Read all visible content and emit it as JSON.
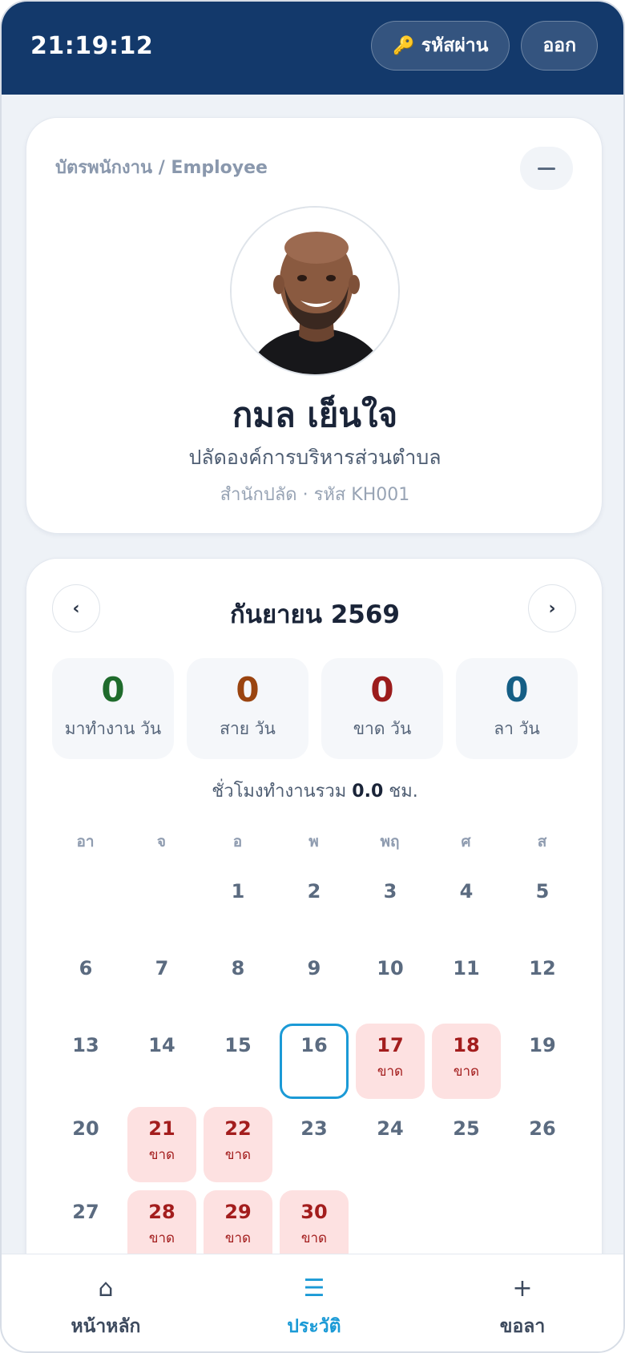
{
  "header": {
    "clock": "21:19:12",
    "password_label": "รหัสผ่าน",
    "password_icon": "key-icon",
    "logout_label": "ออก"
  },
  "employee": {
    "card_label": "บัตรพนักงาน / Employee",
    "name": "กมล เย็นใจ",
    "role": "ปลัดองค์การบริหารส่วนตำบล",
    "meta": "สำนักปลัด · รหัส KH001"
  },
  "calendar": {
    "prev_label": "‹",
    "next_label": "›",
    "month_title": "กันยายน 2569",
    "stats": [
      {
        "value": "0",
        "label": "มาทำงาน วัน",
        "color": "#1f6b2c"
      },
      {
        "value": "0",
        "label": "สาย วัน",
        "color": "#9a4410"
      },
      {
        "value": "0",
        "label": "ขาด วัน",
        "color": "#9b1c1c"
      },
      {
        "value": "0",
        "label": "ลา วัน",
        "color": "#155e85"
      }
    ],
    "hours_prefix": "ชั่วโมงทำงานรวม",
    "hours_value": "0.0",
    "hours_unit": "ชม.",
    "weekdays": [
      "อา",
      "จ",
      "อ",
      "พ",
      "พฤ",
      "ศ",
      "ส"
    ],
    "days": [
      {
        "n": "1",
        "status": ""
      },
      {
        "n": "2",
        "status": ""
      },
      {
        "n": "3",
        "status": ""
      },
      {
        "n": "4",
        "status": ""
      },
      {
        "n": "5",
        "status": ""
      },
      {
        "n": "6",
        "status": ""
      },
      {
        "n": "7",
        "status": ""
      },
      {
        "n": "8",
        "status": ""
      },
      {
        "n": "9",
        "status": ""
      },
      {
        "n": "10",
        "status": ""
      },
      {
        "n": "11",
        "status": ""
      },
      {
        "n": "12",
        "status": ""
      },
      {
        "n": "13",
        "status": ""
      },
      {
        "n": "14",
        "status": ""
      },
      {
        "n": "15",
        "status": ""
      },
      {
        "n": "16",
        "status": "",
        "today": true
      },
      {
        "n": "17",
        "status": "ขาด"
      },
      {
        "n": "18",
        "status": "ขาด"
      },
      {
        "n": "19",
        "status": ""
      },
      {
        "n": "20",
        "status": ""
      },
      {
        "n": "21",
        "status": "ขาด"
      },
      {
        "n": "22",
        "status": "ขาด"
      },
      {
        "n": "23",
        "status": ""
      },
      {
        "n": "24",
        "status": ""
      },
      {
        "n": "25",
        "status": ""
      },
      {
        "n": "26",
        "status": ""
      },
      {
        "n": "27",
        "status": ""
      },
      {
        "n": "28",
        "status": "ขาด"
      },
      {
        "n": "29",
        "status": "ขาด"
      },
      {
        "n": "30",
        "status": "ขาด"
      }
    ]
  },
  "bottom_nav": [
    {
      "icon": "⌂",
      "icon_name": "home-icon",
      "label": "หน้าหลัก",
      "active": false
    },
    {
      "icon": "☰",
      "icon_name": "list-icon",
      "label": "ประวัติ",
      "active": true
    },
    {
      "icon": "+",
      "icon_name": "plus-icon",
      "label": "ขอลา",
      "active": false
    }
  ]
}
